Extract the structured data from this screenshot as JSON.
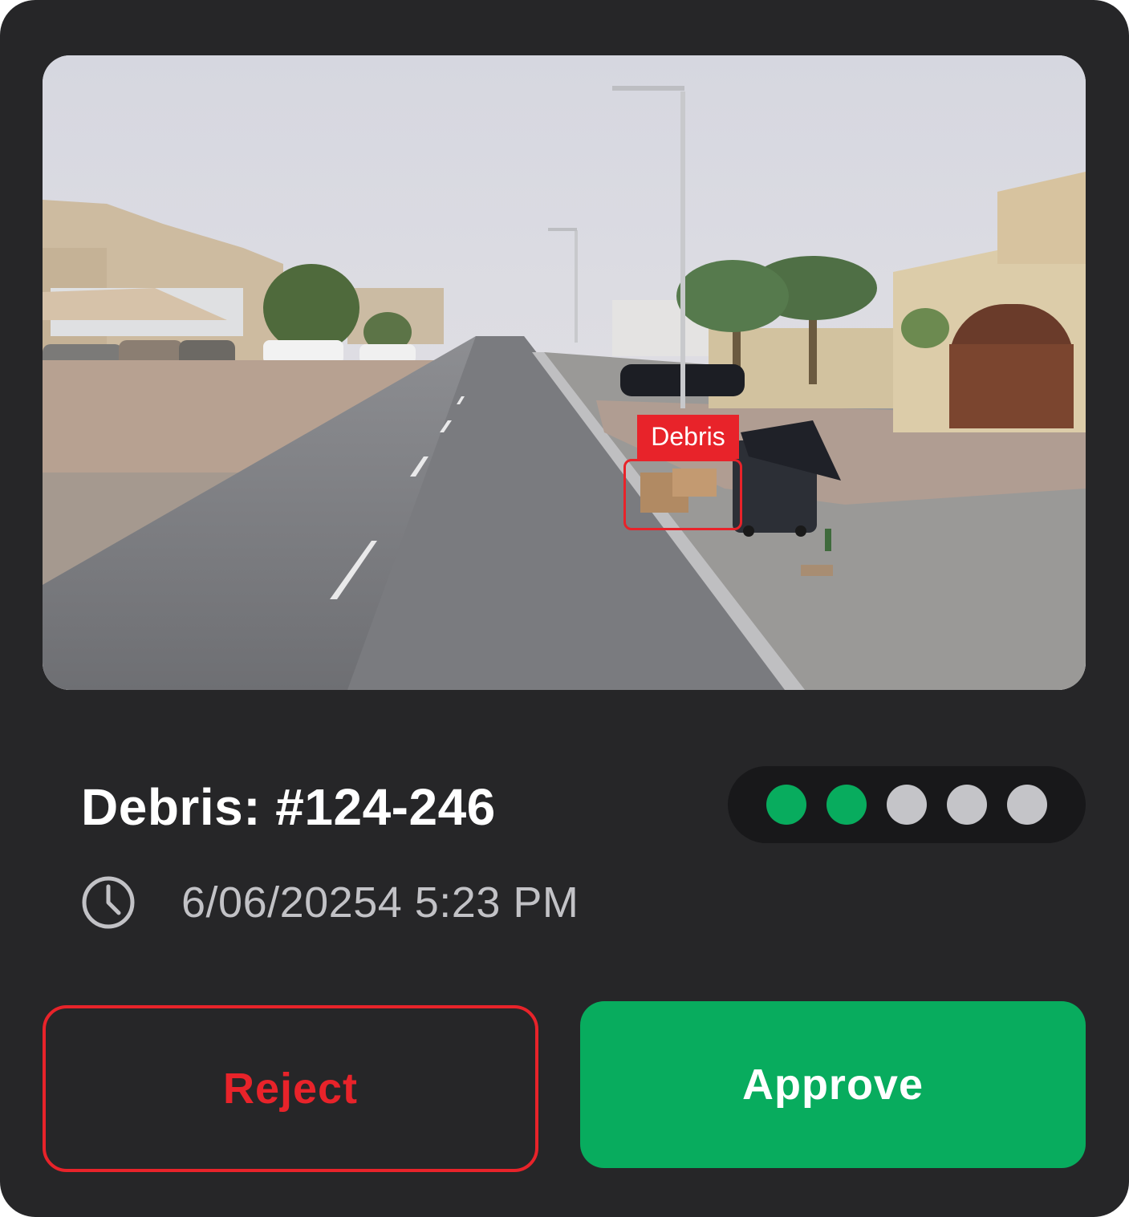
{
  "image": {
    "description_icon": "street-photo",
    "detection": {
      "label": "Debris",
      "color": "#e8232a"
    }
  },
  "report": {
    "title": "Debris: #124-246",
    "timestamp": "6/06/20254 5:23 PM",
    "clock_icon": "clock-icon"
  },
  "severity": {
    "level": 2,
    "max": 5,
    "active_color": "#08ac5e",
    "inactive_color": "#c4c4c8"
  },
  "actions": {
    "reject_label": "Reject",
    "approve_label": "Approve",
    "reject_color": "#e8232a",
    "approve_color": "#08ac5e"
  }
}
